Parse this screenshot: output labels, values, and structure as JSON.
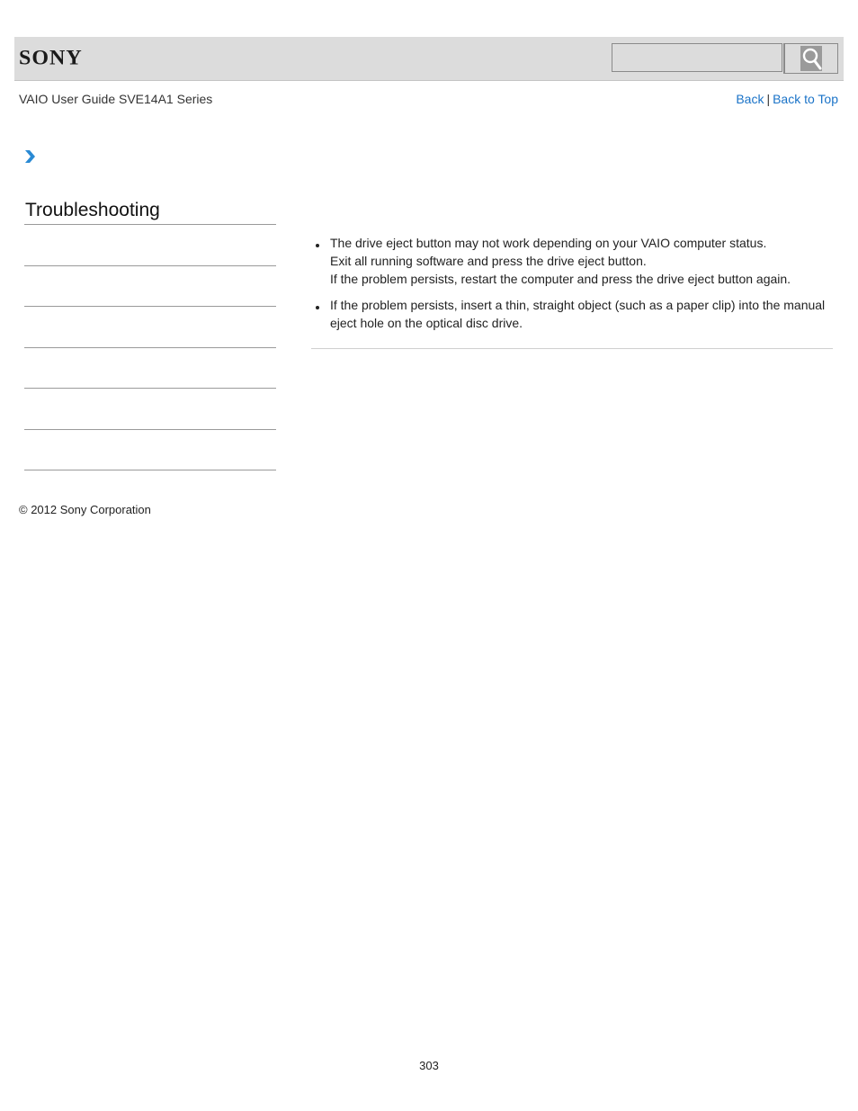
{
  "header": {
    "logo_text": "SONY",
    "search": {
      "placeholder": "",
      "value": ""
    },
    "search_icon": "magnifier-icon",
    "accent_color": "#1a73c8",
    "bar_color": "#dcdcdc"
  },
  "subheader": {
    "guide_title": "VAIO User Guide SVE14A1 Series",
    "nav": {
      "back_label": "Back",
      "separator": "|",
      "back_to_top_label": "Back to Top"
    }
  },
  "breadcrumb": {
    "icon": "chevron-right-icon"
  },
  "sidebar": {
    "title": "Troubleshooting",
    "items": [
      "",
      "",
      "",
      "",
      "",
      ""
    ]
  },
  "main": {
    "bullets": [
      {
        "lines": [
          "The drive eject button may not work depending on your VAIO computer status.",
          "Exit all running software and press the drive eject button.",
          "If the problem persists, restart the computer and press the drive eject button again."
        ]
      },
      {
        "lines": [
          "If the problem persists, insert a thin, straight object (such as a paper clip) into the manual eject hole on the optical disc drive."
        ]
      }
    ]
  },
  "footer": {
    "copyright": "© 2012 Sony Corporation",
    "page_number": "303"
  }
}
